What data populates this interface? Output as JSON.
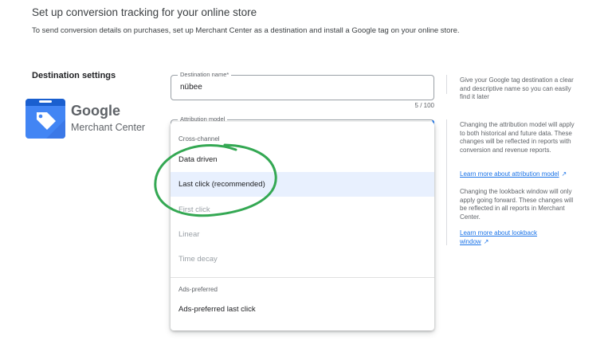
{
  "header": {
    "title": "Set up conversion tracking for your online store",
    "subtitle": "To send conversion details on purchases, set up Merchant Center as a destination and install a Google tag on your online store."
  },
  "destination_settings": {
    "title": "Destination settings",
    "logo": {
      "brand": "Google",
      "product": "Merchant Center",
      "icon": "merchant-center-tag-icon"
    },
    "destination_name": {
      "label": "Destination name*",
      "value": "nübee",
      "count": "5 / 100"
    },
    "attribution_model": {
      "label": "Attribution model"
    }
  },
  "menu": {
    "groups": [
      {
        "label": "Cross-channel",
        "items": [
          {
            "label": "Data driven",
            "state": "enabled"
          },
          {
            "label": "Last click (recommended)",
            "state": "selected"
          },
          {
            "label": "First click",
            "state": "disabled"
          },
          {
            "label": "Linear",
            "state": "disabled"
          },
          {
            "label": "Time decay",
            "state": "disabled"
          }
        ]
      },
      {
        "label": "Ads-preferred",
        "items": [
          {
            "label": "Ads-preferred last click",
            "state": "enabled"
          }
        ]
      }
    ]
  },
  "help": {
    "name_help": "Give your Google tag destination a clear and descriptive name so you can easily find it later",
    "attribution_help": "Changing the attribution model will apply to both historical and future data. These changes will be reflected in reports with conversion and revenue reports.",
    "attribution_link": "Learn more about attribution model",
    "lookback_help": "Changing the lookback window will only apply going forward. These changes will be reflected in all reports in Merchant Center.",
    "lookback_link": "Learn more about lookback window"
  },
  "colors": {
    "accent": "#1a73e8",
    "selected_bg": "#e8f0fe",
    "annotation": "#34a853",
    "logo_blue": "#4285f4"
  }
}
